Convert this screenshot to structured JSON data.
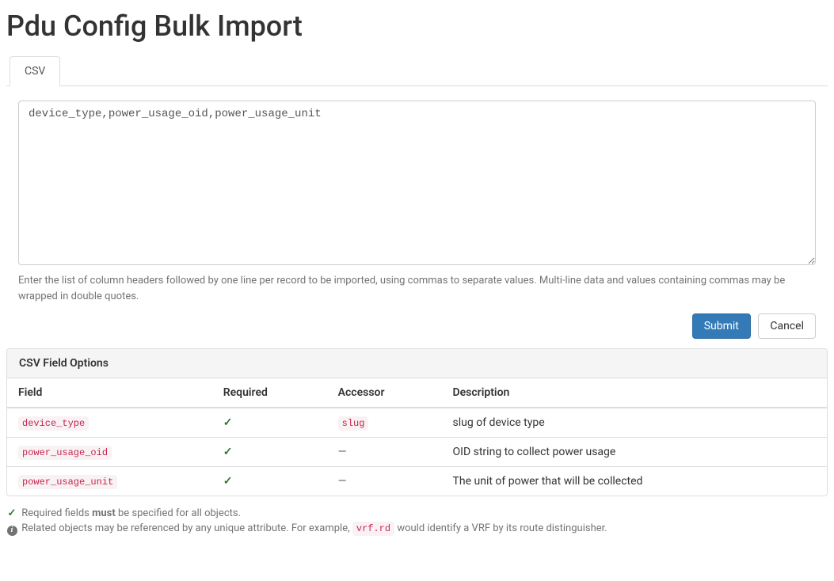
{
  "page": {
    "title": "Pdu Config Bulk Import"
  },
  "tabs": {
    "csv": "CSV"
  },
  "form": {
    "textarea_value": "device_type,power_usage_oid,power_usage_unit",
    "help_text": "Enter the list of column headers followed by one line per record to be imported, using commas to separate values. Multi-line data and values containing commas may be wrapped in double quotes.",
    "submit_label": "Submit",
    "cancel_label": "Cancel"
  },
  "field_panel": {
    "heading": "CSV Field Options",
    "columns": {
      "field": "Field",
      "required": "Required",
      "accessor": "Accessor",
      "description": "Description"
    },
    "rows": [
      {
        "field": "device_type",
        "required": true,
        "accessor": "slug",
        "description": "slug of device type"
      },
      {
        "field": "power_usage_oid",
        "required": true,
        "accessor": "",
        "description": "OID string to collect power usage"
      },
      {
        "field": "power_usage_unit",
        "required": true,
        "accessor": "",
        "description": "The unit of power that will be collected"
      }
    ]
  },
  "footnotes": {
    "required_prefix": "Required fields ",
    "required_bold": "must",
    "required_suffix": " be specified for all objects.",
    "related_prefix": "Related objects may be referenced by any unique attribute. For example, ",
    "related_code": "vrf.rd",
    "related_suffix": " would identify a VRF by its route distinguisher."
  }
}
